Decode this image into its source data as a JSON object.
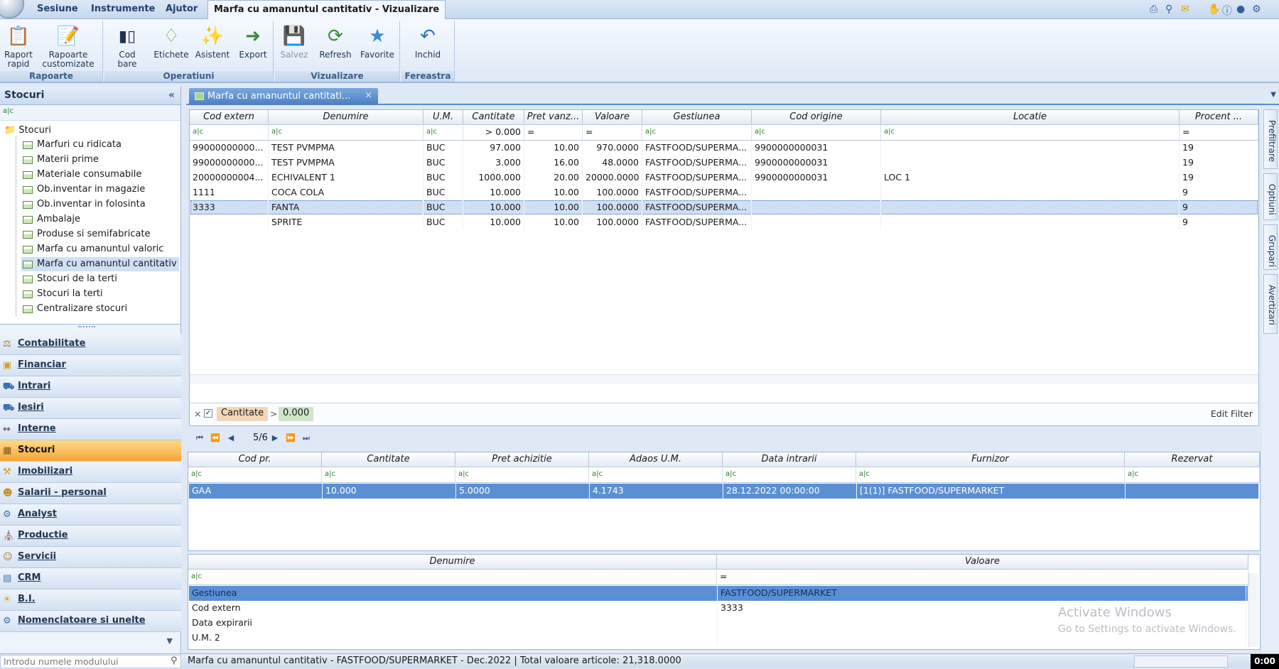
{
  "menubar": {
    "items": [
      "Sesiune",
      "Instrumente",
      "Ajutor"
    ],
    "active_title": "Marfa cu amanuntul cantitativ - Vizualizare"
  },
  "ribbon": {
    "groups": [
      {
        "label": "Rapoarte",
        "buttons": [
          {
            "label": "Raport\nrapid",
            "icon": "report-icon"
          },
          {
            "label": "Rapoarte\ncustomizate",
            "icon": "custom-report-icon"
          }
        ]
      },
      {
        "label": "Operatiuni",
        "buttons": [
          {
            "label": "Cod bare",
            "icon": "barcode-icon"
          },
          {
            "label": "Etichete",
            "icon": "label-tag-icon"
          },
          {
            "label": "Asistent",
            "icon": "wizard-wand-icon"
          },
          {
            "label": "Export",
            "icon": "export-icon"
          }
        ]
      },
      {
        "label": "Vizualizare",
        "buttons": [
          {
            "label": "Salvez",
            "icon": "save-disk-icon"
          },
          {
            "label": "Refresh",
            "icon": "refresh-icon"
          },
          {
            "label": "Favorite",
            "icon": "star-icon"
          }
        ]
      },
      {
        "label": "Fereastra",
        "buttons": [
          {
            "label": "Inchid",
            "icon": "close-window-icon"
          }
        ]
      }
    ]
  },
  "left_panel": {
    "title": "Stocuri",
    "tree_root": "Stocuri",
    "tree_items": [
      "Marfuri cu ridicata",
      "Materii prime",
      "Materiale consumabile",
      "Ob.inventar in magazie",
      "Ob.inventar in folosinta",
      "Ambalaje",
      "Produse si semifabricate",
      "Marfa cu amanuntul valoric",
      "Marfa cu amanuntul cantitativ",
      "Stocuri de la terti",
      "Stocuri la terti",
      "Centralizare stocuri"
    ],
    "selected_tree_item": "Marfa cu amanuntul cantitativ",
    "nav_items": [
      "Contabilitate",
      "Financiar",
      "Intrari",
      "Iesiri",
      "Interne",
      "Stocuri",
      "Imobilizari",
      "Salarii - personal",
      "Analyst",
      "Productie",
      "Servicii",
      "CRM",
      "B.I.",
      "Nomenclatoare si unelte"
    ],
    "active_nav": "Stocuri"
  },
  "main_tab": {
    "title": "Marfa cu amanuntul cantitati..."
  },
  "grid_main": {
    "columns": [
      "Cod extern",
      "Denumire",
      "U.M.",
      "Cantitate",
      "Pret vanz...",
      "Valoare",
      "Gestiunea",
      "Cod origine",
      "Locatie",
      "Procent ..."
    ],
    "filter_row": [
      "a|c",
      "a|c",
      "a|c",
      "> 0.000",
      "=",
      "=",
      "a|c",
      "a|c",
      "a|c",
      "="
    ],
    "rows": [
      [
        "99000000000...",
        "TEST PVMPMA",
        "BUC",
        "97.000",
        "10.00",
        "970.0000",
        "FASTFOOD/SUPERMA...",
        "9900000000031",
        "",
        "19"
      ],
      [
        "99000000000...",
        "TEST PVMPMA",
        "BUC",
        "3.000",
        "16.00",
        "48.0000",
        "FASTFOOD/SUPERMA...",
        "9900000000031",
        "",
        "19"
      ],
      [
        "20000000004...",
        "ECHIVALENT 1",
        "BUC",
        "1000.000",
        "20.00",
        "20000.0000",
        "FASTFOOD/SUPERMA...",
        "9900000000031",
        "LOC 1",
        "19"
      ],
      [
        "1111",
        "COCA COLA",
        "BUC",
        "10.000",
        "10.00",
        "100.0000",
        "FASTFOOD/SUPERMA...",
        "",
        "",
        "9"
      ],
      [
        "3333",
        "FANTA",
        "BUC",
        "10.000",
        "10.00",
        "100.0000",
        "FASTFOOD/SUPERMA...",
        "",
        "",
        "9"
      ],
      [
        "",
        "SPRITE",
        "BUC",
        "10.000",
        "10.00",
        "100.0000",
        "FASTFOOD/SUPERMA...",
        "",
        "",
        "9"
      ]
    ],
    "selected_row": 4,
    "filter": {
      "field": "Cantitate",
      "op": ">",
      "value": "0.000",
      "edit": "Edit Filter"
    },
    "pager": "5/6"
  },
  "grid_detail": {
    "columns": [
      "Cod pr.",
      "Cantitate",
      "Pret achizitie",
      "Adaos U.M.",
      "Data intrarii",
      "Furnizor",
      "Rezervat"
    ],
    "rows": [
      [
        "GAA",
        "10.000",
        "5.0000",
        "4.1743",
        "28.12.2022 00:00:00",
        "[1(1)] FASTFOOD/SUPERMARKET",
        ""
      ]
    ]
  },
  "grid_props": {
    "columns": [
      "Denumire",
      "Valoare"
    ],
    "rows": [
      [
        "Gestiunea",
        "FASTFOOD/SUPERMARKET"
      ],
      [
        "Cod extern",
        "3333"
      ],
      [
        "Data expirarii",
        ""
      ],
      [
        "U.M. 2",
        ""
      ]
    ]
  },
  "right_tabs": [
    "Prefiltrare",
    "Optiuni",
    "Grupari",
    "Avertizari"
  ],
  "status": {
    "placeholder": "Introdu numele modulului",
    "text": "Marfa cu amanuntul cantitativ - FASTFOOD/SUPERMARKET - Dec.2022  | Total valoare articole: 21,318.0000",
    "clock": "0:00"
  },
  "watermark": {
    "line1": "Activate Windows",
    "line2": "Go to Settings to activate Windows."
  }
}
